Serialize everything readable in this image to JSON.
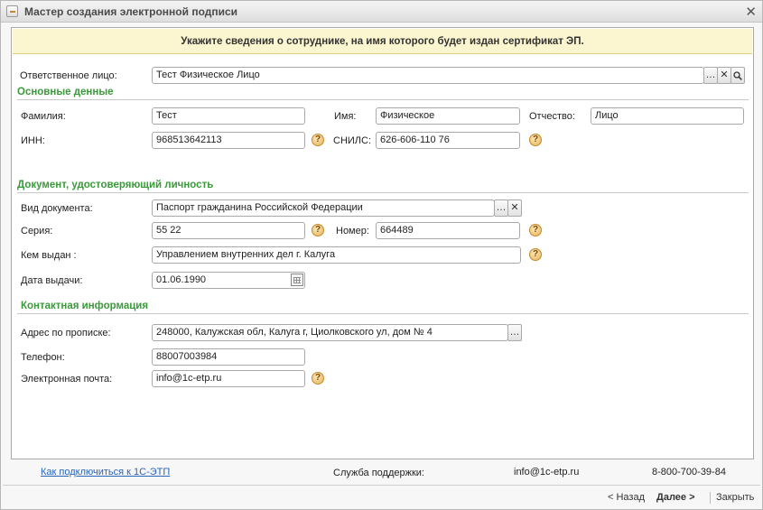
{
  "window": {
    "title": "Мастер создания электронной подписи",
    "close_glyph": "✕"
  },
  "banner": "Укажите сведения о сотруднике, на имя которого будет издан сертификат ЭП.",
  "responsible": {
    "label": "Ответственное лицо:",
    "value": "Тест Физическое Лицо"
  },
  "basic": {
    "title": "Основные денные",
    "last_name_label": "Фамилия:",
    "last_name": "Тест",
    "first_name_label": "Имя:",
    "first_name": "Физическое",
    "middle_name_label": "Отчество:",
    "middle_name": "Лицо",
    "inn_label": "ИНН:",
    "inn": "968513642113",
    "snils_label": "СНИЛС:",
    "snils": "626-606-110 76"
  },
  "document": {
    "title": "Документ, удостоверяющий личность",
    "type_label": "Вид документа:",
    "type": "Паспорт гражданина Российской Федерации",
    "series_label": "Серия:",
    "series": "55 22",
    "number_label": "Номер:",
    "number": "664489",
    "issuer_label": "Кем выдан :",
    "issuer": "Управлением внутренних дел г. Калуга",
    "date_label": "Дата выдачи:",
    "date": "01.06.1990"
  },
  "contact": {
    "title": "Контактная информация",
    "address_label": "Адрес по прописке:",
    "address": "248000, Калужская обл, Калуга г, Циолковского ул, дом № 4",
    "phone_label": "Телефон:",
    "phone": "88007003984",
    "email_label": "Электронная почта:",
    "email": "info@1c-etp.ru"
  },
  "footer": {
    "link": "Как подключиться к 1С-ЭТП",
    "support_label": "Служба поддержки:",
    "support_email": "info@1c-etp.ru",
    "support_phone": "8-800-700-39-84"
  },
  "nav": {
    "back": "< Назад",
    "next": "Далее >",
    "close": "Закрыть"
  },
  "icons": {
    "select": "…",
    "clear": "✕",
    "search": "search-icon",
    "help": "?",
    "calendar": "calendar-icon"
  },
  "colors": {
    "section": "#3a9a3a",
    "banner_bg": "#fbf6cf",
    "link": "#2a64b8"
  }
}
